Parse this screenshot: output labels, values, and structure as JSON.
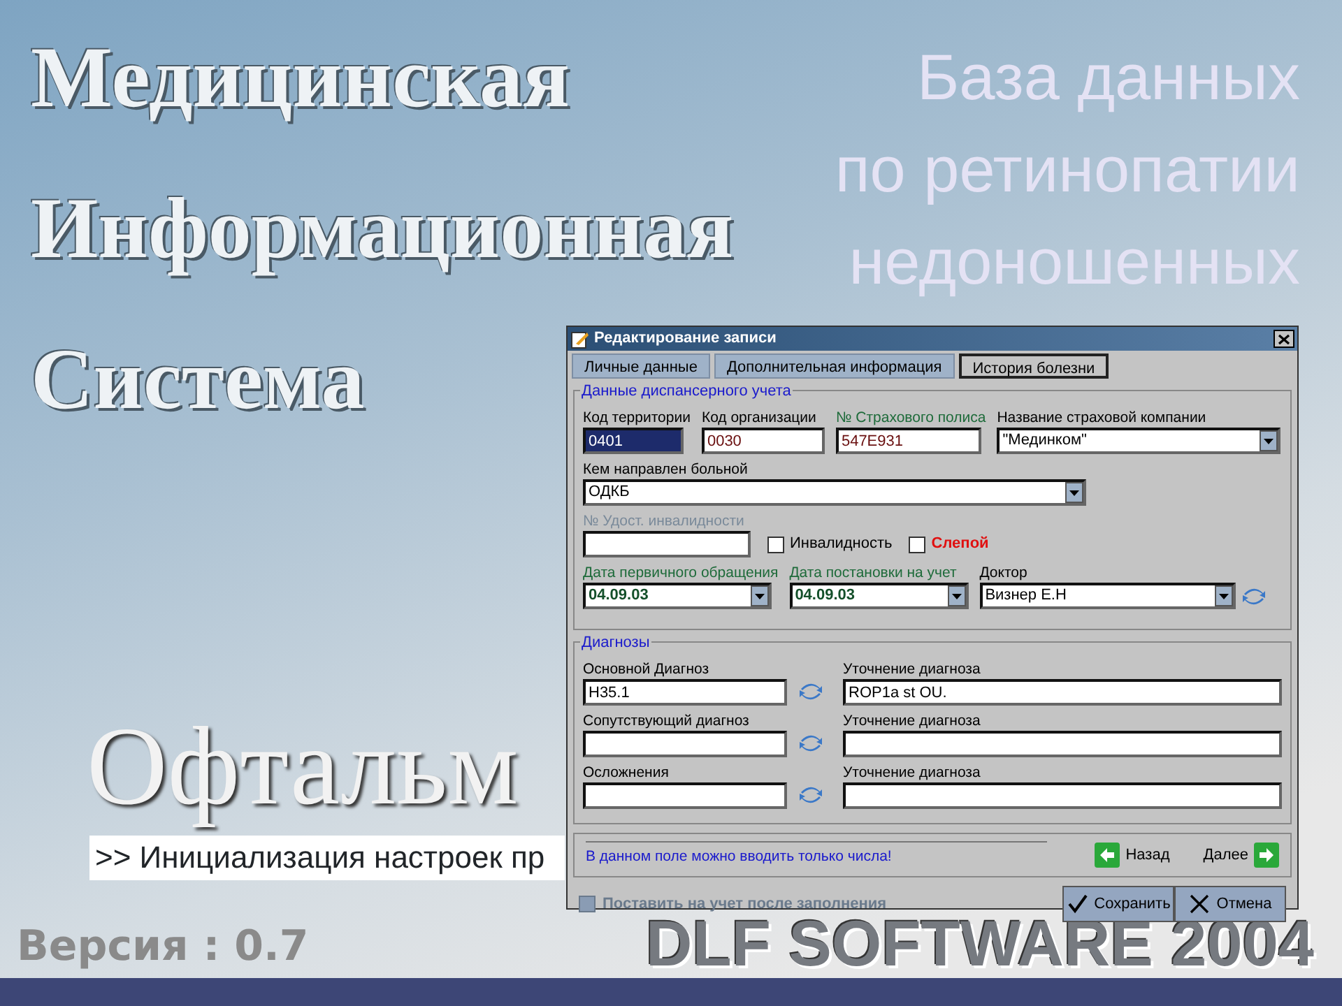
{
  "splash": {
    "title_lines": [
      "Медицинская",
      "Информационная",
      "Система"
    ],
    "module": "Офтальм",
    "status": ">> Инициализация настроек пр",
    "version": "Версия : 0.7",
    "vendor": "DLF SOFTWARE 2004"
  },
  "slide_title": [
    "База данных",
    "по ретинопатии",
    "недоношенных"
  ],
  "dialog": {
    "title": "Редактирование записи",
    "tabs": [
      {
        "label": "Личные данные",
        "selected": false
      },
      {
        "label": "Дополнительная информация",
        "selected": false
      },
      {
        "label": "История болезни",
        "selected": true
      }
    ],
    "registration": {
      "legend": "Данные диспансерного учета",
      "rows": [
        [
          {
            "kind": "text",
            "label": "Код территории",
            "value": "0401",
            "required": false,
            "highlighted": true
          },
          {
            "kind": "text",
            "label": "Код организации",
            "value": "0030",
            "required": false,
            "highlighted": false
          },
          {
            "kind": "text",
            "label": "№ Страхового полиса",
            "value": "547E931",
            "required": true,
            "highlighted": false
          },
          {
            "kind": "combo",
            "label": "Название страховой компании",
            "value": "\"Мединком\"",
            "required": false
          }
        ],
        [
          {
            "kind": "combo",
            "label": "Кем направлен больной",
            "value": "ОДКБ",
            "required": false
          }
        ],
        [
          {
            "kind": "text",
            "label": "№ Удост. инвалидности",
            "required": false,
            "disabled": true,
            "highlighted": false
          },
          {
            "kind": "checkbox",
            "label": "Инвалидность",
            "checked": false,
            "alert": false
          },
          {
            "kind": "checkbox",
            "label": "Слепой",
            "checked": false,
            "alert": true
          }
        ],
        [
          {
            "kind": "date",
            "label": "Дата первичного обращения",
            "value": "04.09.03",
            "required": true
          },
          {
            "kind": "date",
            "label": "Дата постановки на учет",
            "value": "04.09.03",
            "required": true
          },
          {
            "kind": "combo",
            "label": "Доктор",
            "value": "Визнер Е.Н",
            "required": false,
            "lookup": true
          }
        ]
      ]
    },
    "diagnoses": {
      "legend": "Диагнозы",
      "rows": [
        {
          "label": "Основной Диагноз",
          "value": "H35.1",
          "detail_label": "Уточнение диагноза",
          "detail_value": "ROP1a st OU."
        },
        {
          "label": "Сопутствующий диагноз",
          "detail_label": "Уточнение диагноза"
        },
        {
          "label": "Осложнения",
          "detail_label": "Уточнение диагноза"
        }
      ]
    },
    "message": "В данном поле можно вводить только числа!",
    "back": "Назад",
    "next": "Далее",
    "register_after": {
      "label": "Поставить на учет после заполнения",
      "checked": false,
      "disabled": true
    },
    "buttons": [
      "Сохранить",
      "Отмена"
    ]
  }
}
